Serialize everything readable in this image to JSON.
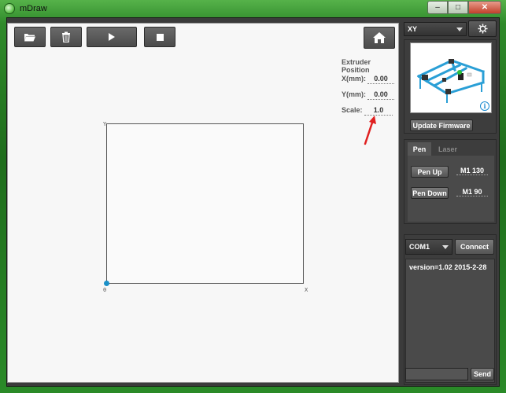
{
  "window": {
    "title": "mDraw"
  },
  "titlebar_buttons": {
    "minimize": "–",
    "maximize": "□",
    "close": "✕"
  },
  "toolbar": {
    "open_icon": "folder-open-icon",
    "delete_icon": "trash-icon",
    "play_icon": "play-icon",
    "stop_icon": "stop-icon",
    "home_icon": "home-icon"
  },
  "extruder": {
    "heading": "Extruder Position",
    "x_label": "X(mm):",
    "x_value": "0.00",
    "y_label": "Y(mm):",
    "y_value": "0.00",
    "scale_label": "Scale:",
    "scale_value": "1.0"
  },
  "canvas": {
    "y_axis": "Y",
    "x_axis": "X",
    "origin": "0",
    "origin_color": "#1a90c8"
  },
  "machine": {
    "selected": "XY",
    "update_label": "Update Firmware",
    "info_glyph": "i"
  },
  "pen_panel": {
    "tabs": [
      "Pen",
      "Laser"
    ],
    "active_tab": "Pen",
    "pen_up_label": "Pen Up",
    "pen_up_value": "M1 130",
    "pen_down_label": "Pen Down",
    "pen_down_value": "M1 90"
  },
  "connection": {
    "port": "COM1",
    "connect_label": "Connect",
    "console_text": "version=1.02 2015-2-28",
    "send_label": "Send",
    "input_value": ""
  },
  "colors": {
    "accent": "#1a90c8",
    "panel_bg": "#3d3d3d",
    "canvas_bg": "#f7f7f7",
    "arrow": "#e02020"
  }
}
